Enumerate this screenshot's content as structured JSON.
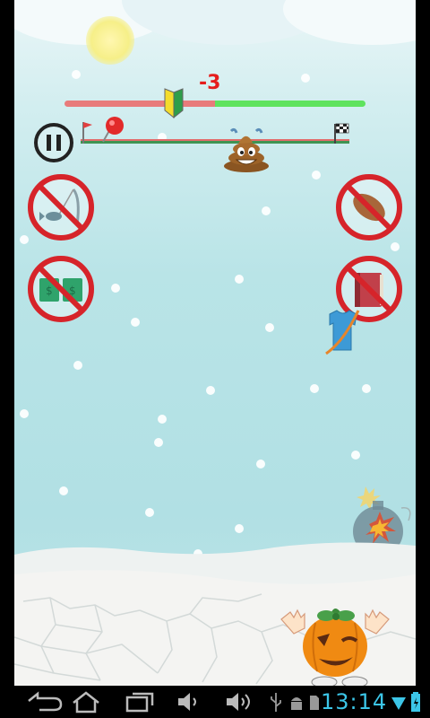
{
  "hud": {
    "score_delta": "-3"
  },
  "progress": {
    "needle_fraction": 0.5
  },
  "status_bar": {
    "time": "13:14"
  },
  "icons": {
    "pause": "pause-icon",
    "start": "start-flag-icon",
    "finish": "checkered-flag-icon",
    "player_marker": "poop-emoji-icon",
    "beginner": "beginner-leaf-icon",
    "forbidden": [
      "no-fishing-rod-icon",
      "no-money-icon",
      "no-football-icon",
      "no-book-icon"
    ],
    "falling": [
      "shirt-icon",
      "bomb-icon"
    ],
    "player": "pumpkin-character-icon"
  },
  "colors": {
    "score": "#e51d1d",
    "bar_left": "#e87b7b",
    "bar_right": "#5ee35e",
    "track_front": "#3f9453",
    "ban_sign": "#d6242a",
    "clock": "#3cc6e8"
  }
}
